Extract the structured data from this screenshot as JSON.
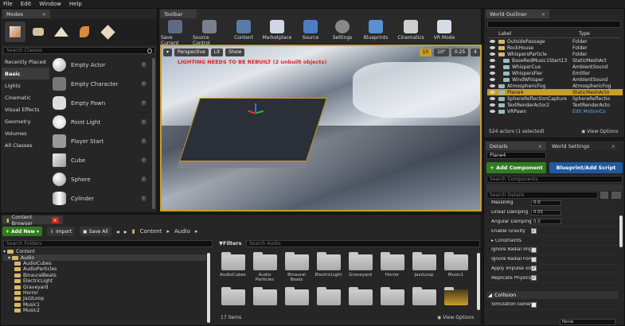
{
  "menu": [
    "File",
    "Edit",
    "Window",
    "Help"
  ],
  "modes": {
    "tab": "Modes",
    "search_placeholder": "Search Classes",
    "categories": [
      "Recently Placed",
      "Basic",
      "Lights",
      "Cinematic",
      "Visual Effects",
      "Geometry",
      "Volumes",
      "All Classes"
    ],
    "items": [
      "Empty Actor",
      "Empty Character",
      "Empty Pawn",
      "Point Light",
      "Player Start",
      "Cube",
      "Sphere",
      "Cylinder"
    ]
  },
  "toolbar": {
    "tab": "Toolbar",
    "buttons": [
      "Save Current",
      "Source Control",
      "Content",
      "Marketplace",
      "Source",
      "Settings",
      "Blueprints",
      "Cinematics",
      "VR Mode"
    ]
  },
  "viewport": {
    "perspective": "Perspective",
    "lit": "Lit",
    "show": "Show",
    "warning": "LIGHTING NEEDS TO BE REBUILT (2 unbuilt objects)",
    "grid": "10",
    "angle": "10°",
    "scale": "0.25",
    "cam": "4"
  },
  "outliner": {
    "tab": "World Outliner",
    "col_label": "Label",
    "col_type": "Type",
    "rows": [
      {
        "label": "OutsidePassage",
        "type": "Folder",
        "indent": 1
      },
      {
        "label": "RockHouse",
        "type": "Folder",
        "indent": 1
      },
      {
        "label": "WhispersParticle",
        "type": "Folder",
        "indent": 1
      },
      {
        "label": "BaseRedMusic1Start13",
        "type": "StaticMeshAct",
        "indent": 2
      },
      {
        "label": "WhisperCue",
        "type": "AmbientSound",
        "indent": 2
      },
      {
        "label": "WhispersFier",
        "type": "Emitter",
        "indent": 2
      },
      {
        "label": "WindWhisper",
        "type": "AmbientSound",
        "indent": 2
      },
      {
        "label": "AtmosphericFog",
        "type": "AtmosphericFog",
        "indent": 1
      },
      {
        "label": "Plane4",
        "type": "StaticMeshActo",
        "indent": 1,
        "selected": true
      },
      {
        "label": "SphereReflectionCapture",
        "type": "SphereReflectio",
        "indent": 1
      },
      {
        "label": "TextRenderActor2",
        "type": "TextRenderActo",
        "indent": 1
      },
      {
        "label": "VRPawn",
        "type": "Edit MotionCo",
        "indent": 1
      }
    ],
    "count": "524 actors (1 selected)",
    "view_options": "View Options"
  },
  "details": {
    "tab": "Details",
    "tab2": "World Settings",
    "name": "Plane4",
    "add_component": "+ Add Component",
    "blueprint": "Blueprint/Add Script",
    "search_components": "Search Components",
    "search_details": "Search Details",
    "props": [
      {
        "label": "MassInKg",
        "value": "0.0",
        "kind": "val"
      },
      {
        "label": "Linear Damping",
        "value": "0.01",
        "kind": "val"
      },
      {
        "label": "Angular Damping",
        "value": "0.0",
        "kind": "val"
      },
      {
        "label": "Enable Gravity",
        "value": "✓",
        "kind": "chk"
      },
      {
        "label": "Constraints",
        "value": "",
        "kind": "head"
      },
      {
        "label": "Ignore Radial Impu",
        "value": "",
        "kind": "chk"
      },
      {
        "label": "Ignore Radial Force",
        "value": "",
        "kind": "chk"
      },
      {
        "label": "Apply Impulse on D",
        "value": "✓",
        "kind": "chk"
      },
      {
        "label": "Replicate Physics",
        "value": "✓",
        "kind": "chk"
      }
    ],
    "collision": "Collision",
    "sim_gen": "Simulation Genera",
    "none": "None"
  },
  "content": {
    "tab": "Content Browser",
    "add_new": "Add New",
    "import": "Import",
    "save_all": "Save All",
    "path": [
      "Content",
      "Audio"
    ],
    "search_folders": "Search Folders",
    "filters": "Filters",
    "search_audio": "Search Audio",
    "tree": [
      "Content",
      "Audio",
      "AudioCubes",
      "AudioParticles",
      "BinauralBeats",
      "ElectricLight",
      "Graveyard",
      "Horror",
      "JazzLoop",
      "Music1",
      "Music2"
    ],
    "tiles": [
      "AudioCubes",
      "Audio Particles",
      "Binaural Beats",
      "ElectricLight",
      "Graveyard",
      "Horror",
      "JazzLoop",
      "Music1"
    ],
    "items_count": "17 items",
    "view_options": "View Options"
  }
}
